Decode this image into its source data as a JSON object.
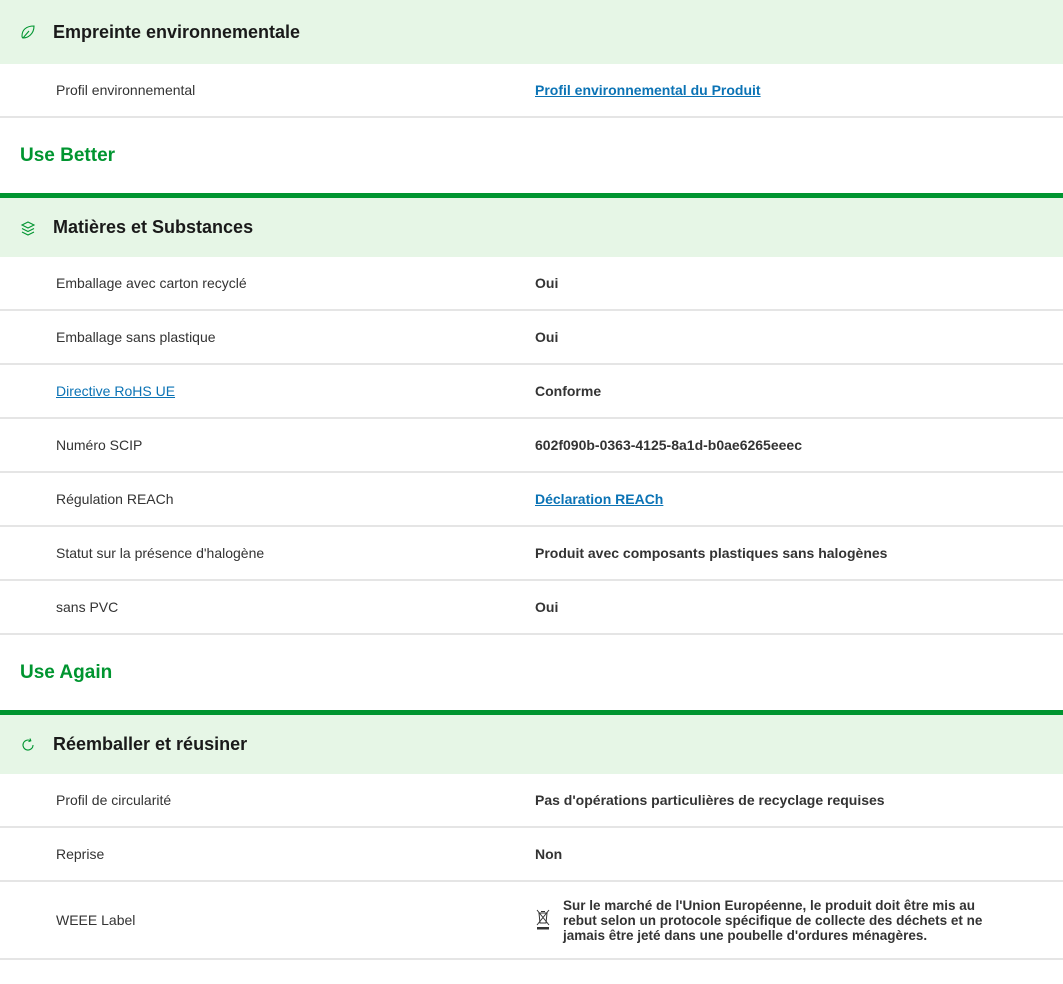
{
  "sections": {
    "environmental": {
      "title": "Empreinte environnementale",
      "icon": "leaf-icon",
      "rows": [
        {
          "label": "Profil environnemental",
          "value": "Profil environnemental du Produit"
        }
      ]
    },
    "use_better": {
      "group_title": "Use Better",
      "title": "Matières et Substances",
      "icon": "layers-icon",
      "rows": [
        {
          "label": "Emballage avec carton recyclé",
          "value": "Oui"
        },
        {
          "label": "Emballage sans plastique",
          "value": "Oui"
        },
        {
          "label": "Directive RoHS UE",
          "value": "Conforme"
        },
        {
          "label": "Numéro SCIP",
          "value": "602f090b-0363-4125-8a1d-b0ae6265eeec"
        },
        {
          "label": "Régulation REACh",
          "value": "Déclaration REACh"
        },
        {
          "label": "Statut sur la présence d'halogène",
          "value": "Produit avec composants plastiques sans halogènes"
        },
        {
          "label": "sans PVC",
          "value": "Oui"
        }
      ]
    },
    "use_again": {
      "group_title": "Use Again",
      "title": "Réemballer et réusiner",
      "icon": "refresh-icon",
      "rows": [
        {
          "label": "Profil de circularité",
          "value": "Pas d'opérations particulières de recyclage requises"
        },
        {
          "label": "Reprise",
          "value": "Non"
        },
        {
          "label": "WEEE Label",
          "value": "Sur le marché de l'Union Européenne, le produit doit être mis au rebut selon un protocole spécifique de collecte des déchets et ne jamais être jeté dans une poubelle d'ordures ménagères.",
          "icon": "weee-bin-icon"
        }
      ]
    }
  },
  "colors": {
    "accent_green": "#009530",
    "header_bg": "#e6f6e6",
    "link_blue": "#0b73b5",
    "divider": "#e5e5e5"
  }
}
